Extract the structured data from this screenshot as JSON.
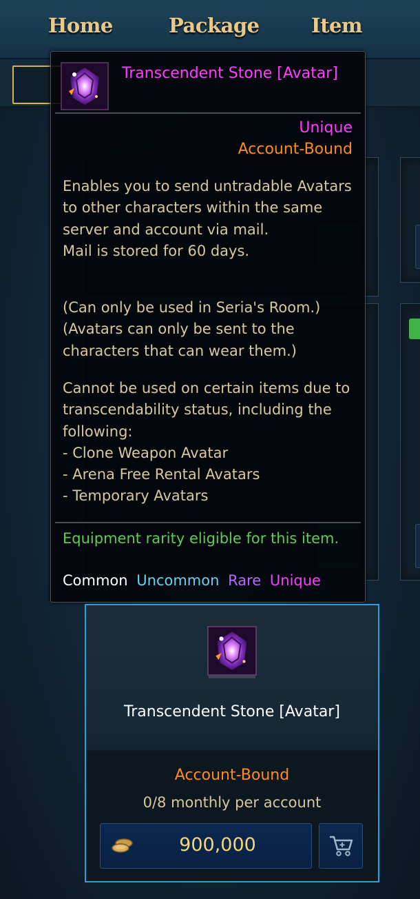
{
  "nav": {
    "items": [
      "Home",
      "Package",
      "Item"
    ]
  },
  "tooltip": {
    "name": "Transcendent Stone [Avatar]",
    "icon": "transcendent-stone-icon",
    "rarity": "Unique",
    "binding": "Account-Bound",
    "description_1": "Enables you to send untradable Avatars to other characters within the same server and account via mail.\nMail is stored for 60 days.",
    "description_2": "(Can only be used in Seria's Room.)\n(Avatars can only be sent to the characters that can wear them.)",
    "description_3": "Cannot be used on certain items due to transcendability status, including the following:\n- Clone Weapon Avatar\n- Arena Free Rental Avatars\n- Temporary Avatars",
    "eligibility_label": "Equipment rarity eligible for this item.",
    "eligible_rarities": [
      {
        "label": "Common",
        "color": "#ffffff"
      },
      {
        "label": "Uncommon",
        "color": "#68d2ef"
      },
      {
        "label": "Rare",
        "color": "#b36bff"
      },
      {
        "label": "Unique",
        "color": "#ff3dff"
      }
    ]
  },
  "card": {
    "name": "Transcendent Stone [Avatar]",
    "binding": "Account-Bound",
    "limit": "0/8 monthly per account",
    "price": "900,000",
    "price_icon": "gold-coins-icon",
    "cart_icon": "cart-icon",
    "accent_color": "#2aa0d8"
  }
}
